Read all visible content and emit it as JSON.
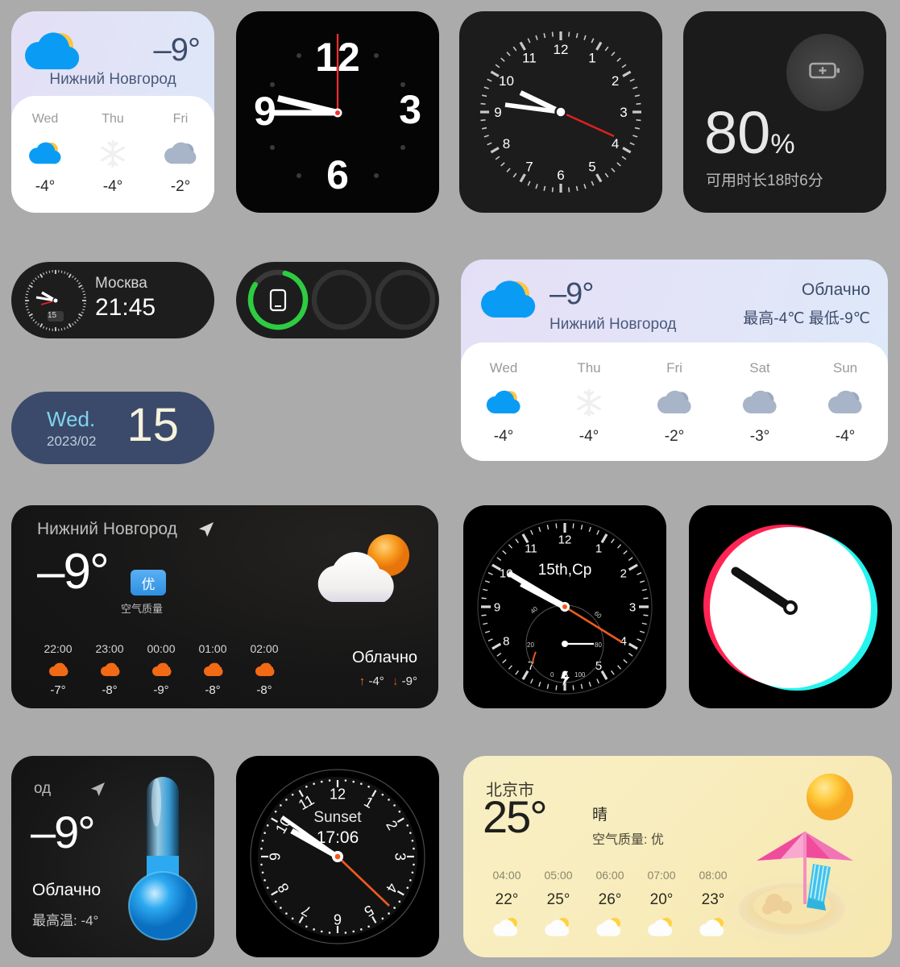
{
  "background_color": "#ababab",
  "widgets": {
    "weather_small": {
      "name": "weather-small-widget",
      "temp": "–9°",
      "city": "Нижний Новгород",
      "forecast": [
        {
          "day": "Wed",
          "icon": "cloud-sun-icon",
          "temp": "-4°"
        },
        {
          "day": "Thu",
          "icon": "snowflake-icon",
          "temp": "-4°"
        },
        {
          "day": "Fri",
          "icon": "cloud-gray-icon",
          "temp": "-2°"
        }
      ]
    },
    "clock_digital": {
      "name": "digital-numerals-clock",
      "numerals": [
        "12",
        "3",
        "6",
        "9"
      ],
      "hand_color": "#ff2d2d"
    },
    "clock_analog": {
      "name": "analog-clock-widget",
      "numerals": [
        "12",
        "1",
        "2",
        "3",
        "4",
        "5",
        "6",
        "7",
        "8",
        "9",
        "10",
        "11"
      ],
      "second_hand_color": "#e02020"
    },
    "battery": {
      "name": "battery-widget",
      "percent": "80",
      "percent_sign": "%",
      "sub": "可用时长18时6分",
      "icon": "battery-plus-icon",
      "level": 80
    },
    "moscow_clock": {
      "name": "moscow-clock-pill",
      "city": "Москва",
      "time": "21:45",
      "date_badge": "15"
    },
    "battery_rings": {
      "name": "battery-rings-pill",
      "ring_color": "#2ecc40",
      "ring_percent": 80,
      "icons": [
        "phone-icon",
        "empty-ring",
        "empty-ring"
      ]
    },
    "weather_big": {
      "name": "weather-large-widget",
      "temp": "–9°",
      "city": "Нижний Новгород",
      "condition": "Облачно",
      "high_low": "最高-4℃  最低-9℃",
      "forecast": [
        {
          "day": "Wed",
          "icon": "cloud-sun-icon",
          "temp": "-4°"
        },
        {
          "day": "Thu",
          "icon": "snowflake-icon",
          "temp": "-4°"
        },
        {
          "day": "Fri",
          "icon": "cloud-gray-icon",
          "temp": "-2°"
        },
        {
          "day": "Sat",
          "icon": "cloud-gray-icon",
          "temp": "-3°"
        },
        {
          "day": "Sun",
          "icon": "cloud-gray-icon",
          "temp": "-4°"
        }
      ]
    },
    "date_pill": {
      "name": "date-pill-widget",
      "dow": "Wed.",
      "ym": "2023/02",
      "day": "15",
      "bg": "#3b4a6b",
      "dow_color": "#7fd4ee"
    },
    "weather_dark": {
      "name": "weather-dark-wide-widget",
      "city": "Нижний Новгород",
      "location_icon": "navigation-arrow-icon",
      "temp": "–9°",
      "aqi_badge": "优",
      "aqi_label": "空气质量",
      "condition": "Облачно",
      "high": "-4°",
      "low": "-9°",
      "hourly": [
        {
          "time": "22:00",
          "icon": "cloud-moon-icon",
          "temp": "-7°"
        },
        {
          "time": "23:00",
          "icon": "cloud-moon-icon",
          "temp": "-8°"
        },
        {
          "time": "00:00",
          "icon": "cloud-moon-icon",
          "temp": "-9°"
        },
        {
          "time": "01:00",
          "icon": "cloud-moon-icon",
          "temp": "-8°"
        },
        {
          "time": "02:00",
          "icon": "cloud-moon-icon",
          "temp": "-8°"
        }
      ]
    },
    "chronograph": {
      "name": "chronograph-clock-widget",
      "center_text": "15th,Cp",
      "subdial_labels": [
        "0",
        "20",
        "40",
        "60",
        "80",
        "100"
      ],
      "second_hand_color": "#ef5a1e"
    },
    "tik_clock": {
      "name": "white-circle-clock-widget",
      "ring_colors": [
        "#ff2453",
        "#25f4ee"
      ]
    },
    "thermometer": {
      "name": "thermometer-weather-widget",
      "city": "од",
      "location_icon": "navigation-arrow-icon",
      "temp": "–9°",
      "condition": "Облачно",
      "high": "最高温:  -4°"
    },
    "sunset_clock": {
      "name": "sunset-clock-widget",
      "label": "Sunset",
      "time": "17:06",
      "second_hand_color": "#ef5a1e"
    },
    "beach_weather": {
      "name": "beach-weather-widget",
      "city": "北京市",
      "temp": "25°",
      "condition": "晴",
      "aqi": "空气质量: 优",
      "hourly": [
        {
          "time": "04:00",
          "temp": "22°",
          "icon": "cloud-sun-icon"
        },
        {
          "time": "05:00",
          "temp": "25°",
          "icon": "cloud-sun-icon"
        },
        {
          "time": "06:00",
          "temp": "26°",
          "icon": "cloud-sun-icon"
        },
        {
          "time": "07:00",
          "temp": "20°",
          "icon": "cloud-sun-icon"
        },
        {
          "time": "08:00",
          "temp": "23°",
          "icon": "cloud-sun-icon"
        }
      ]
    }
  }
}
